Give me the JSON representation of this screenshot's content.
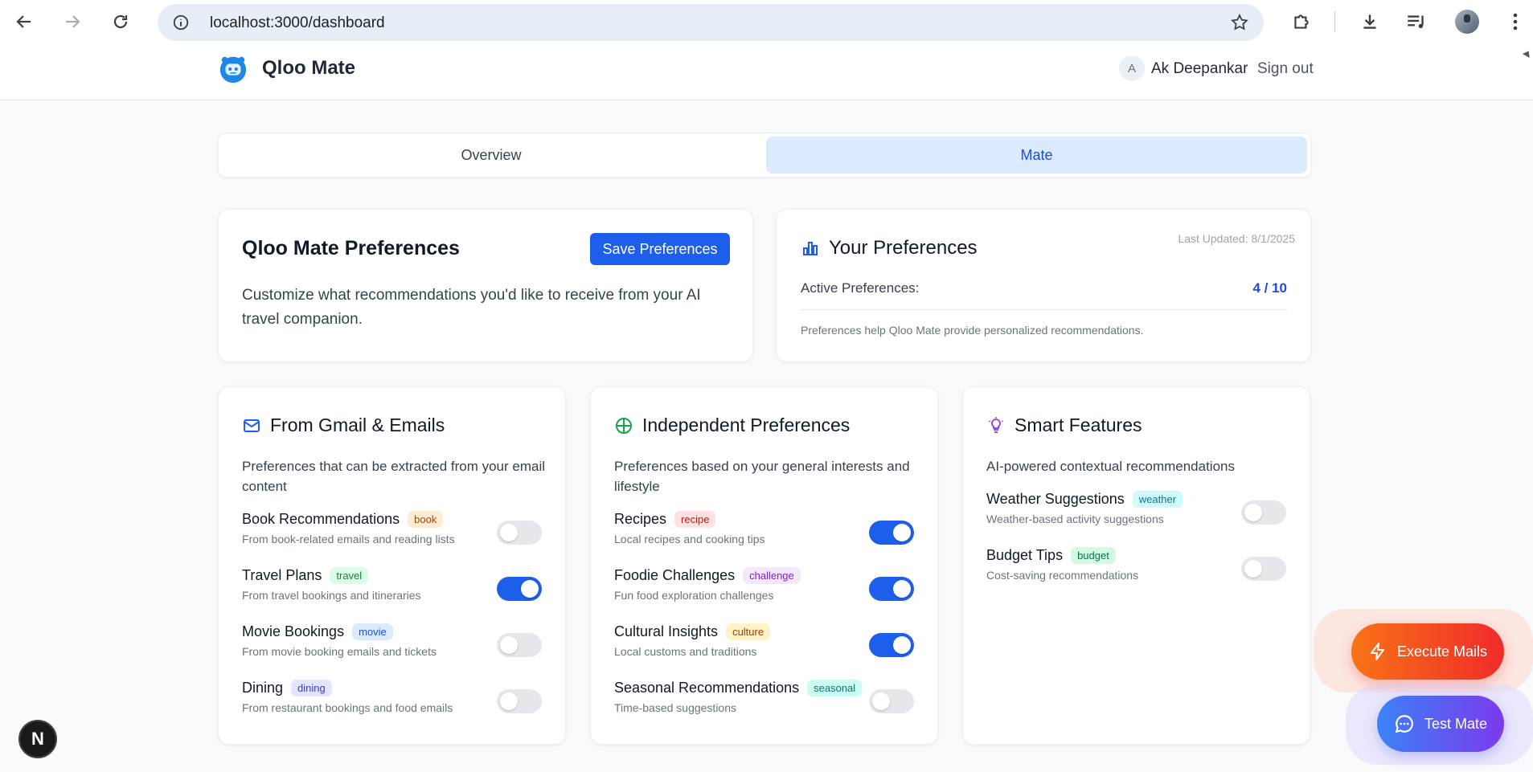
{
  "browser": {
    "url": "localhost:3000/dashboard"
  },
  "header": {
    "brand": "Qloo Mate",
    "user_initial": "A",
    "user_name": "Ak Deepankar",
    "sign_out": "Sign out"
  },
  "tabs": [
    {
      "label": "Overview",
      "active": false
    },
    {
      "label": "Mate",
      "active": true
    }
  ],
  "preferences_card": {
    "title": "Qloo Mate Preferences",
    "save_label": "Save Preferences",
    "description": "Customize what recommendations you'd like to receive from your AI travel companion."
  },
  "your_preferences": {
    "title": "Your Preferences",
    "last_updated": "Last Updated: 8/1/2025",
    "active_label": "Active Preferences:",
    "active_count": "4 / 10",
    "note": "Preferences help Qloo Mate provide personalized recommendations."
  },
  "sections": [
    {
      "title": "From Gmail & Emails",
      "icon": "mail-icon",
      "description": "Preferences that can be extracted from your email content",
      "items": [
        {
          "label": "Book Recommendations",
          "badge": "book",
          "subtitle": "From book-related emails and reading lists",
          "enabled": false
        },
        {
          "label": "Travel Plans",
          "badge": "travel",
          "subtitle": "From travel bookings and itineraries",
          "enabled": true
        },
        {
          "label": "Movie Bookings",
          "badge": "movie",
          "subtitle": "From movie booking emails and tickets",
          "enabled": false
        },
        {
          "label": "Dining",
          "badge": "dining",
          "subtitle": "From restaurant bookings and food emails",
          "enabled": false
        }
      ]
    },
    {
      "title": "Independent Preferences",
      "icon": "globe-icon",
      "description": "Preferences based on your general interests and lifestyle",
      "items": [
        {
          "label": "Recipes",
          "badge": "recipe",
          "subtitle": "Local recipes and cooking tips",
          "enabled": true
        },
        {
          "label": "Foodie Challenges",
          "badge": "challenge",
          "subtitle": "Fun food exploration challenges",
          "enabled": true
        },
        {
          "label": "Cultural Insights",
          "badge": "culture",
          "subtitle": "Local customs and traditions",
          "enabled": true
        },
        {
          "label": "Seasonal Recommendations",
          "badge": "seasonal",
          "subtitle": "Time-based suggestions",
          "enabled": false
        }
      ]
    },
    {
      "title": "Smart Features",
      "icon": "lightbulb-icon",
      "description": "AI-powered contextual recommendations",
      "items": [
        {
          "label": "Weather Suggestions",
          "badge": "weather",
          "subtitle": "Weather-based activity suggestions",
          "enabled": false
        },
        {
          "label": "Budget Tips",
          "badge": "budget",
          "subtitle": "Cost-saving recommendations",
          "enabled": false
        }
      ]
    }
  ],
  "floating": {
    "execute_label": "Execute Mails",
    "test_label": "Test Mate",
    "dev_badge": "N"
  },
  "colors": {
    "primary": "#1d5eea",
    "badge_book": "#fdebd3",
    "badge_travel": "#dcfce7",
    "badge_movie": "#dbeafe",
    "badge_dining": "#e0e7ff",
    "badge_recipe": "#fee2e2",
    "badge_challenge": "#f3e8ff",
    "badge_culture": "#fef3c7",
    "badge_seasonal": "#ccfbf1",
    "badge_weather": "#cffafe",
    "badge_budget": "#d1fae5"
  }
}
